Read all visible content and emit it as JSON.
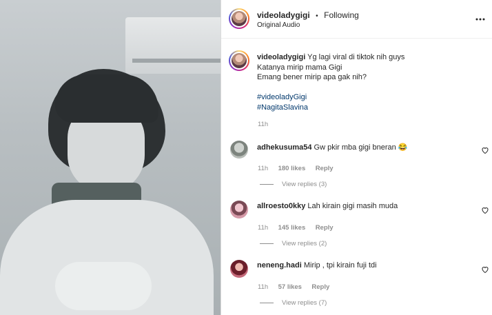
{
  "post": {
    "username": "videoladygigi",
    "separator": "•",
    "following_label": "Following",
    "audio_label": "Original Audio",
    "more_icon": "more-horizontal-icon"
  },
  "caption": {
    "username": "videoladygigi",
    "lines": [
      "Yg lagi viral di tiktok nih guys",
      "Katanya mirip mama Gigi",
      "Emang bener mirip apa gak nih?"
    ],
    "hashtags": [
      "#videoladyGigi",
      "#NagitaSlavina"
    ],
    "time": "11h"
  },
  "comments": [
    {
      "username": "adhekusuma54",
      "text": "Gw pkir mba gigi bneran",
      "emoji": "😂",
      "time": "11h",
      "likes": "180 likes",
      "reply": "Reply",
      "view_replies": "View replies (3)"
    },
    {
      "username": "allroesto0kky",
      "text": "Lah kirain gigi masih muda",
      "emoji": "",
      "time": "11h",
      "likes": "145 likes",
      "reply": "Reply",
      "view_replies": "View replies (2)"
    },
    {
      "username": "neneng.hadi",
      "text": "Mirip , tpi kirain fuji tdi",
      "emoji": "",
      "time": "11h",
      "likes": "57 likes",
      "reply": "Reply",
      "view_replies": "View replies (7)"
    }
  ]
}
